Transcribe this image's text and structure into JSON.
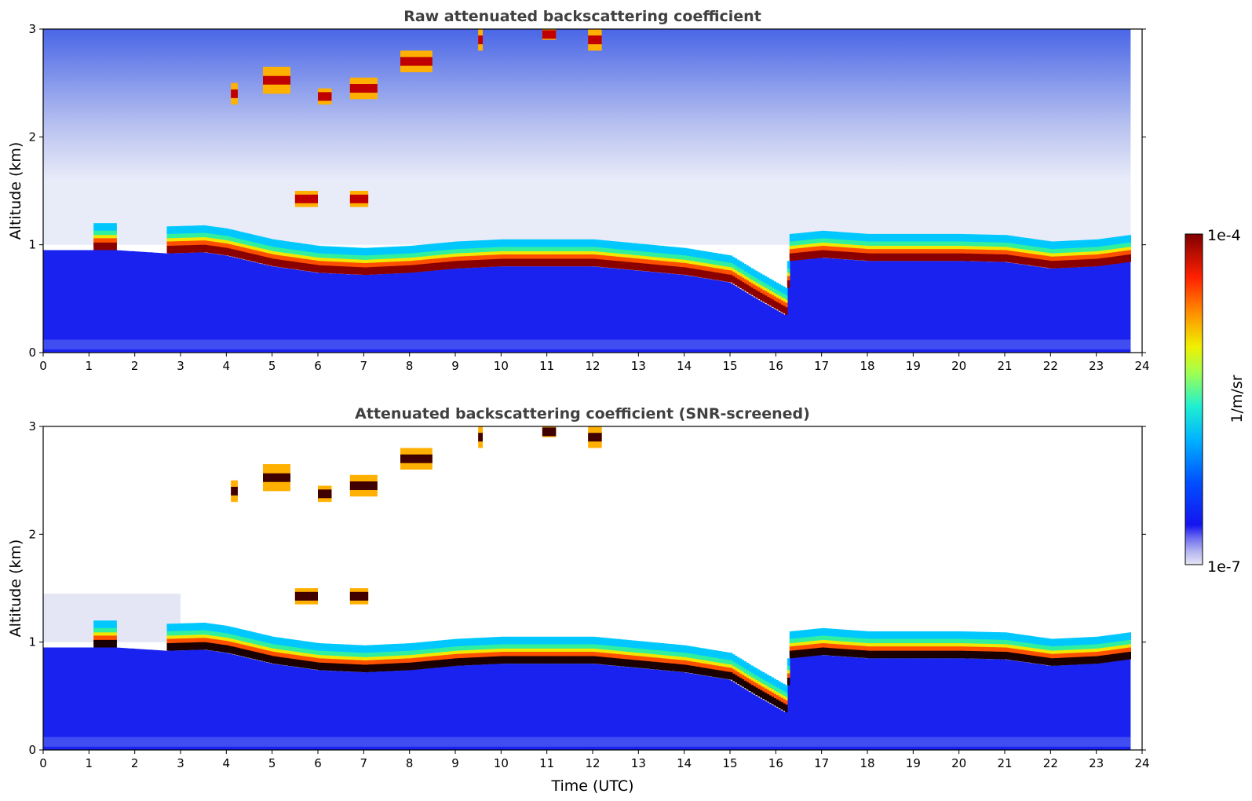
{
  "chart_data": [
    {
      "type": "heatmap",
      "title": "Raw attenuated backscattering coefficient",
      "xlabel": "",
      "ylabel": "Altitude (km)",
      "xlim": [
        0,
        24
      ],
      "ylim": [
        0,
        3
      ],
      "x_ticks": [
        "0",
        "1",
        "2",
        "3",
        "4",
        "5",
        "6",
        "7",
        "8",
        "9",
        "10",
        "11",
        "12",
        "13",
        "14",
        "15",
        "16",
        "17",
        "18",
        "19",
        "20",
        "21",
        "22",
        "23",
        "24"
      ],
      "y_ticks": [
        "0",
        "1",
        "2",
        "3"
      ],
      "data_end_time": 23.75,
      "screened": false,
      "colorscale": "jet",
      "noise_background": true
    },
    {
      "type": "heatmap",
      "title": "Attenuated backscattering coefficient (SNR-screened)",
      "xlabel": "Time (UTC)",
      "ylabel": "Altitude (km)",
      "xlim": [
        0,
        24
      ],
      "ylim": [
        0,
        3
      ],
      "x_ticks": [
        "0",
        "1",
        "2",
        "3",
        "4",
        "5",
        "6",
        "7",
        "8",
        "9",
        "10",
        "11",
        "12",
        "13",
        "14",
        "15",
        "16",
        "17",
        "18",
        "19",
        "20",
        "21",
        "22",
        "23",
        "24"
      ],
      "y_ticks": [
        "0",
        "1",
        "2",
        "3"
      ],
      "data_end_time": 23.75,
      "screened": true,
      "colorscale": "jet",
      "noise_background": false
    }
  ],
  "layer_profile": {
    "description_units": "time in UTC hours, altitude in km",
    "cloud_base_km": [
      [
        1.1,
        0.95
      ],
      [
        1.6,
        0.95
      ],
      [
        2.7,
        0.92
      ],
      [
        3.5,
        0.93
      ],
      [
        4.0,
        0.9
      ],
      [
        5.0,
        0.8
      ],
      [
        6.0,
        0.74
      ],
      [
        7.0,
        0.72
      ],
      [
        8.0,
        0.74
      ],
      [
        9.0,
        0.78
      ],
      [
        10.0,
        0.8
      ],
      [
        11.0,
        0.8
      ],
      [
        12.0,
        0.8
      ],
      [
        13.0,
        0.76
      ],
      [
        14.0,
        0.72
      ],
      [
        15.0,
        0.65
      ],
      [
        15.5,
        0.52
      ],
      [
        16.2,
        0.35
      ],
      [
        16.3,
        0.85
      ],
      [
        17.0,
        0.88
      ],
      [
        18.0,
        0.85
      ],
      [
        19.0,
        0.85
      ],
      [
        20.0,
        0.85
      ],
      [
        21.0,
        0.84
      ],
      [
        22.0,
        0.78
      ],
      [
        23.0,
        0.8
      ],
      [
        23.7,
        0.84
      ]
    ],
    "elevated_cloud_patches": [
      {
        "t0": 4.1,
        "t1": 4.25,
        "z0": 2.3,
        "z1": 2.5
      },
      {
        "t0": 4.8,
        "t1": 5.4,
        "z0": 2.4,
        "z1": 2.65
      },
      {
        "t0": 6.0,
        "t1": 6.3,
        "z0": 2.3,
        "z1": 2.45
      },
      {
        "t0": 6.7,
        "t1": 7.3,
        "z0": 2.35,
        "z1": 2.55
      },
      {
        "t0": 7.8,
        "t1": 8.5,
        "z0": 2.6,
        "z1": 2.8
      },
      {
        "t0": 9.5,
        "t1": 9.6,
        "z0": 2.8,
        "z1": 3.0
      },
      {
        "t0": 10.9,
        "t1": 11.2,
        "z0": 2.9,
        "z1": 3.0
      },
      {
        "t0": 11.9,
        "t1": 12.2,
        "z0": 2.8,
        "z1": 3.0
      },
      {
        "t0": 5.5,
        "t1": 6.0,
        "z0": 1.35,
        "z1": 1.5
      },
      {
        "t0": 6.7,
        "t1": 7.1,
        "z0": 1.35,
        "z1": 1.5
      }
    ]
  },
  "colorbar": {
    "label": "1/m/sr",
    "max_label": "1e-4",
    "min_label": "1e-7"
  },
  "colors": {
    "background": "#ffffff",
    "title": "#404040",
    "axis": "#000000"
  }
}
